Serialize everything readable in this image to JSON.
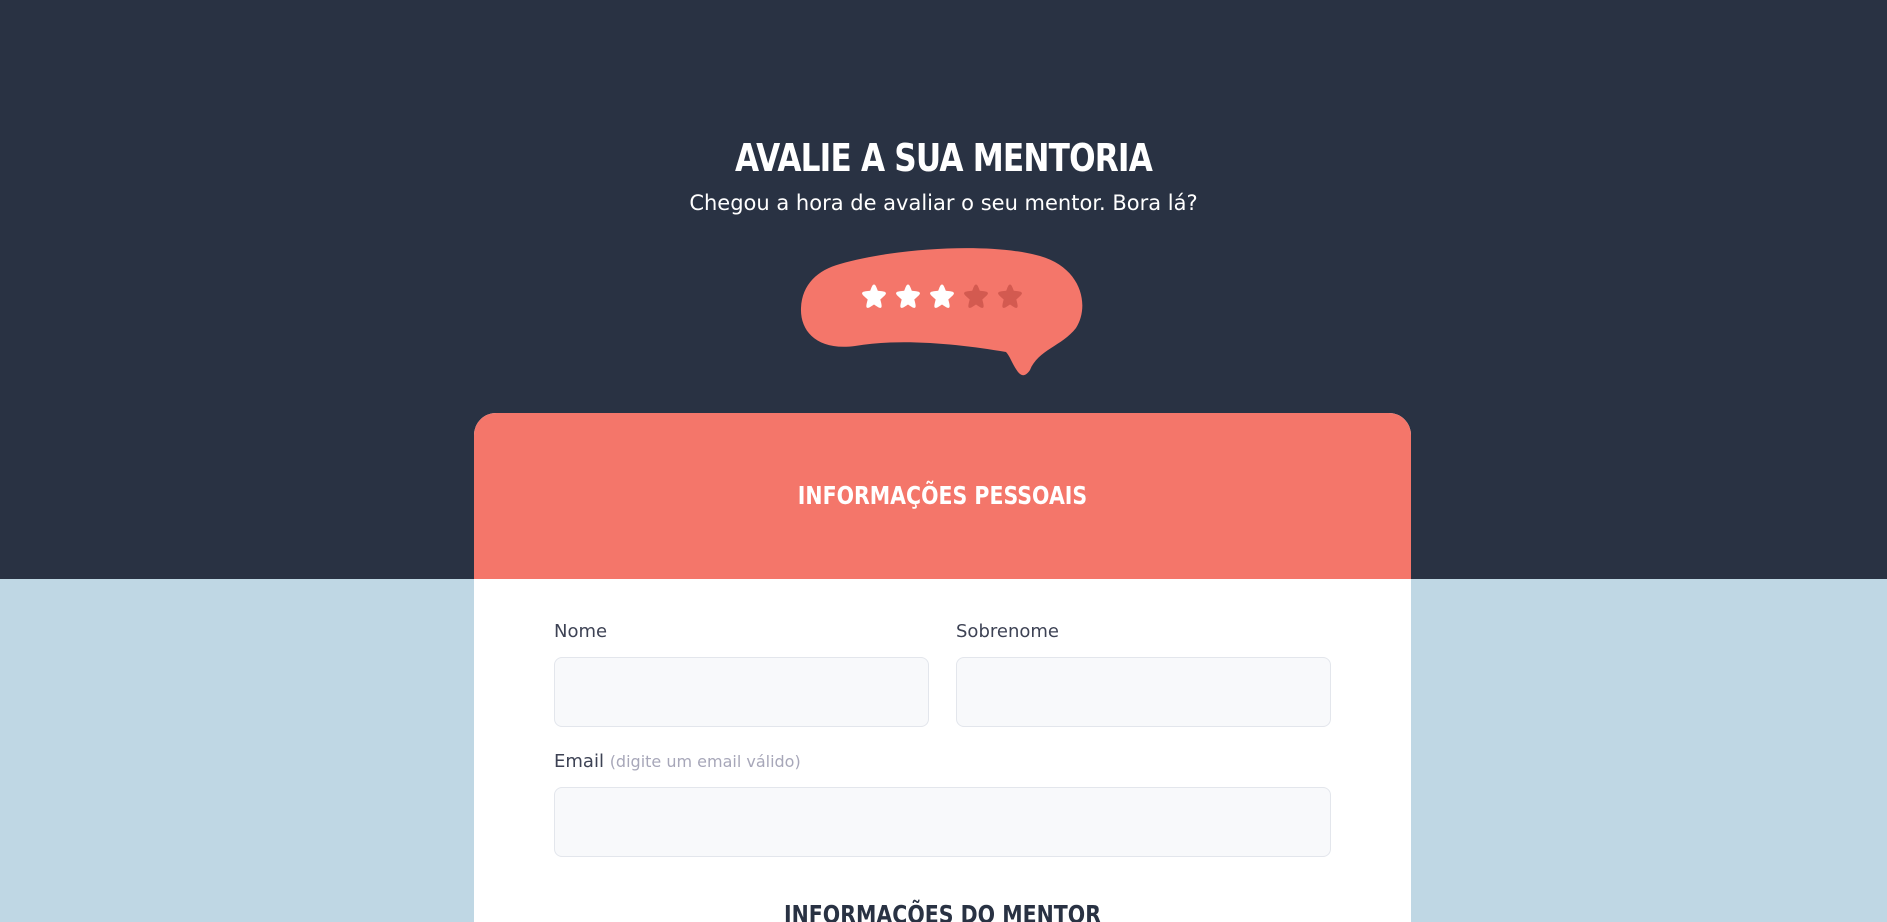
{
  "hero": {
    "title": "AVALIE A SUA MENTORIA",
    "subtitle": "Chegou a hora de avaliar o seu mentor. Bora lá?"
  },
  "rating": {
    "value": 3,
    "max": 5,
    "icon": "star-icon",
    "bubble_color": "#f4766a",
    "filled_color": "#ffffff",
    "empty_color": "#d35a50"
  },
  "form": {
    "section_personal": "INFORMAÇÕES PESSOAIS",
    "first_name": {
      "label": "Nome",
      "value": "",
      "placeholder": ""
    },
    "last_name": {
      "label": "Sobrenome",
      "value": "",
      "placeholder": ""
    },
    "email": {
      "label": "Email",
      "hint": "(digite um email válido)",
      "value": "",
      "placeholder": ""
    },
    "section_mentor": "INFORMAÇÕES DO MENTOR"
  },
  "colors": {
    "hero_bg": "#293243",
    "page_bg": "#bfd7e4",
    "accent": "#f4766a",
    "card_bg": "#ffffff"
  }
}
